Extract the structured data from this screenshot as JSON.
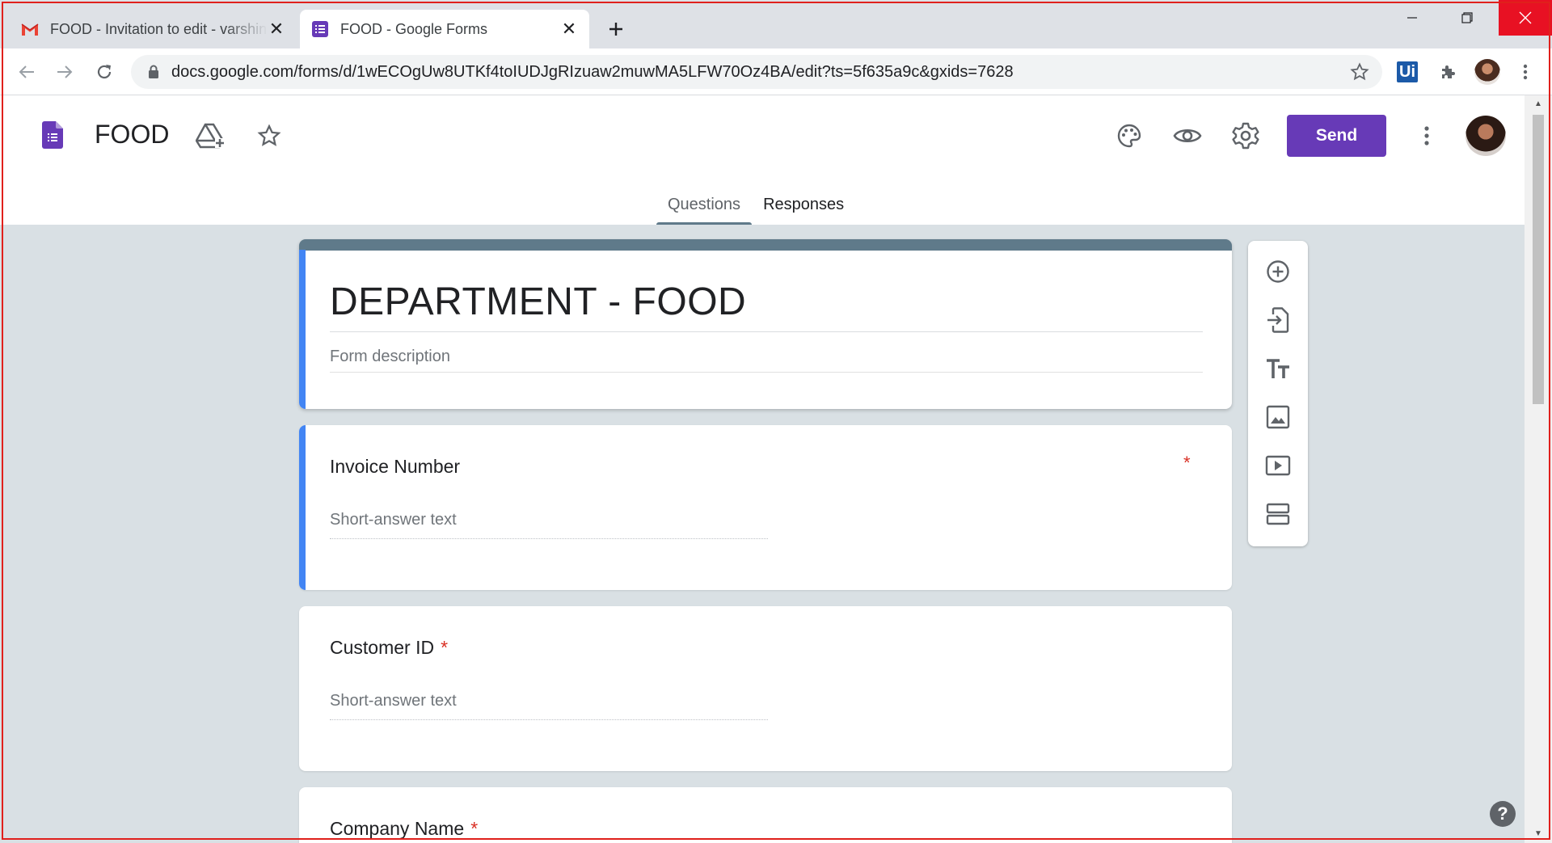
{
  "browser": {
    "tabs": [
      {
        "title": "FOOD - Invitation to edit - varshini",
        "icon": "gmail-icon",
        "active": false
      },
      {
        "title": "FOOD - Google Forms",
        "icon": "google-forms-icon",
        "active": true
      }
    ],
    "url": "docs.google.com/forms/d/1wECOgUw8UTKf4toIUDJgRIzuaw2muwMA5LFW70Oz4BA/edit?ts=5f635a9c&gxids=7628",
    "extension_label": "Ui"
  },
  "header": {
    "doc_title": "FOOD",
    "send_label": "Send",
    "brand_color": "#673ab7"
  },
  "form_tabs": [
    {
      "label": "Questions",
      "active": true
    },
    {
      "label": "Responses",
      "active": false
    }
  ],
  "form": {
    "title": "DEPARTMENT - FOOD",
    "description_placeholder": "Form description",
    "header_color": "#5f7a8a",
    "questions": [
      {
        "label": "Invoice Number",
        "placeholder": "Short-answer text",
        "required": true,
        "required_mark": "*"
      },
      {
        "label": "Customer ID",
        "placeholder": "Short-answer text",
        "required": true,
        "required_mark": "*"
      },
      {
        "label": "Company Name",
        "required": true,
        "required_mark": "*"
      }
    ]
  },
  "side_toolbar": [
    "add-question-icon",
    "import-questions-icon",
    "add-title-icon",
    "add-image-icon",
    "add-video-icon",
    "add-section-icon"
  ],
  "help_label": "?"
}
